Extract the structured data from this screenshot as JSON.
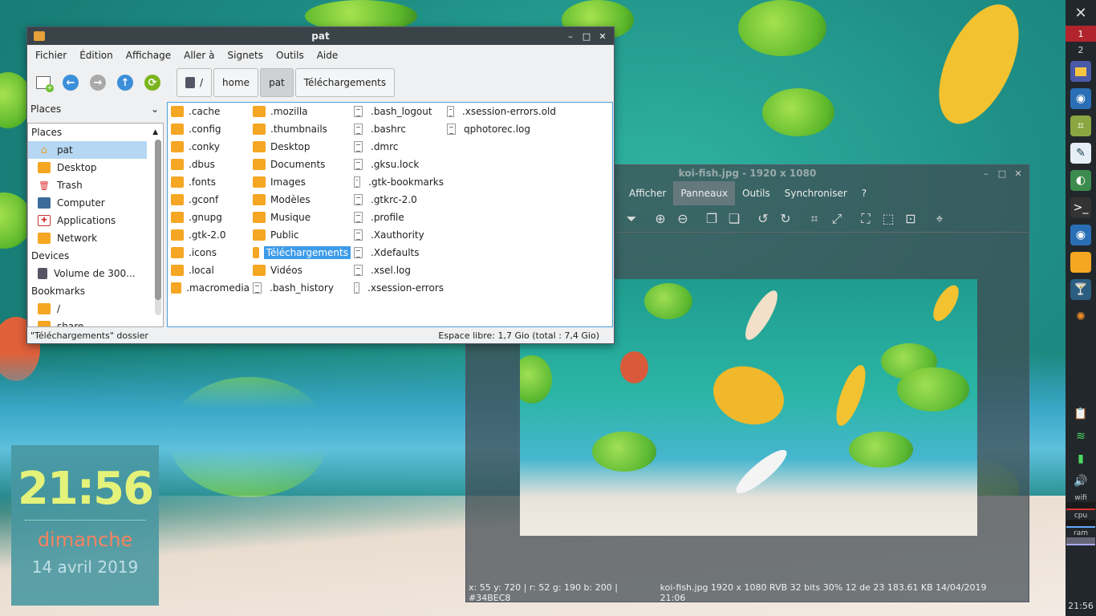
{
  "file_manager": {
    "title": "pat",
    "menu": [
      "Fichier",
      "Édition",
      "Affichage",
      "Aller à",
      "Signets",
      "Outils",
      "Aide"
    ],
    "breadcrumbs": [
      "/",
      "home",
      "pat",
      "Téléchargements"
    ],
    "sidebar_header": "Places",
    "sidebar": {
      "places_label": "Places",
      "places": [
        "pat",
        "Desktop",
        "Trash",
        "Computer",
        "Applications",
        "Network"
      ],
      "devices_label": "Devices",
      "devices": [
        "Volume de 300..."
      ],
      "bookmarks_label": "Bookmarks",
      "bookmarks": [
        "/",
        "share"
      ]
    },
    "files": {
      "col1": [
        ".cache",
        ".config",
        ".conky",
        ".dbus",
        ".fonts",
        ".gconf",
        ".gnupg",
        ".gtk-2.0",
        ".icons",
        ".local",
        ".macromedia"
      ],
      "col2": [
        ".mozilla",
        ".thumbnails",
        "Desktop",
        "Documents",
        "Images",
        "Modèles",
        "Musique",
        "Public",
        "Téléchargements",
        "Vidéos",
        ".bash_history"
      ],
      "col3": [
        ".bash_logout",
        ".bashrc",
        ".dmrc",
        ".gksu.lock",
        ".gtk-bookmarks",
        ".gtkrc-2.0",
        ".profile",
        ".Xauthority",
        ".Xdefaults",
        ".xsel.log",
        ".xsession-errors"
      ],
      "col4": [
        ".xsession-errors.old",
        "qphotorec.log"
      ]
    },
    "status_left": "\"Téléchargements\" dossier",
    "status_right": "Espace libre: 1,7 Gio (total : 7,4 Gio)"
  },
  "image_viewer": {
    "title": "koi-fish.jpg - 1920 x 1080",
    "menu": [
      "Afficher",
      "Panneaux",
      "Outils",
      "Synchroniser",
      "?"
    ],
    "status_left": "x: 55 y: 720 | r: 52 g: 190 b: 200 | #34BEC8",
    "status_right": "koi-fish.jpg   1920 x 1080   RVB 32 bits   30%   12 de 23   183.61 KB   14/04/2019 21:06"
  },
  "clock_widget": {
    "time": "21:56",
    "day": "dimanche",
    "date": "14 avril 2019"
  },
  "panel": {
    "workspaces": [
      "1",
      "2"
    ],
    "labels": {
      "wifi": "wifi",
      "cpu": "cpu",
      "ram": "ram"
    },
    "clock": "21:56"
  },
  "colors": {
    "accent": "#3d9be9",
    "folder": "#f5a623",
    "clock_time": "#e4f27a",
    "clock_day": "#f5835f"
  }
}
